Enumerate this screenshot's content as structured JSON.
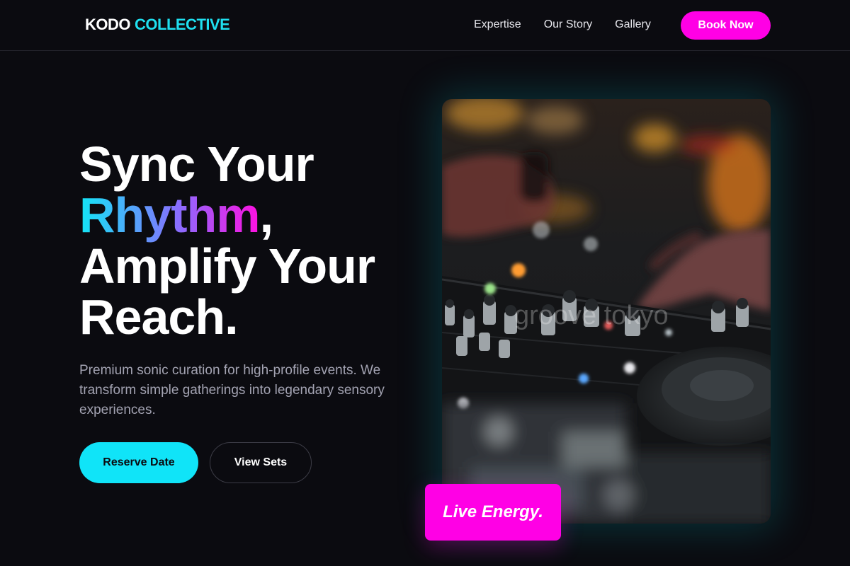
{
  "brand": {
    "name_part1": "KODO",
    "name_part2": "COLLECTIVE"
  },
  "nav": {
    "items": [
      "Expertise",
      "Our Story",
      "Gallery"
    ],
    "cta": "Book Now"
  },
  "hero": {
    "line1": "Sync Your",
    "accent_word": "Rhythm",
    "accent_suffix": ",",
    "line3": "Amplify Your",
    "line4": "Reach.",
    "subtitle": "Premium sonic curation for high-profile events. We transform simple gatherings into legendary sensory experiences.",
    "primary_button": "Reserve Date",
    "secondary_button": "View Sets"
  },
  "image": {
    "overlay_text": "groove tokyo",
    "badge": "Live Energy."
  },
  "colors": {
    "background": "#0b0b10",
    "accent_cyan": "#10e4f8",
    "accent_magenta": "#ff00e5"
  }
}
